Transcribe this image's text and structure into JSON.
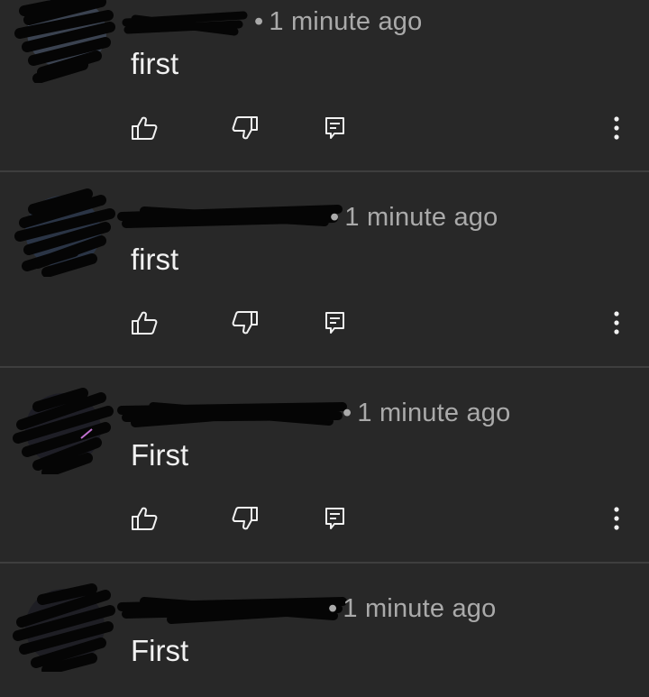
{
  "comments": [
    {
      "timestamp": "1 minute ago",
      "dot": "•",
      "text": "first",
      "icons": [
        "like-icon",
        "dislike-icon",
        "reply-icon",
        "more-vert-icon"
      ]
    },
    {
      "timestamp": "1 minute ago",
      "dot": "•",
      "text": "first",
      "icons": [
        "like-icon",
        "dislike-icon",
        "reply-icon",
        "more-vert-icon"
      ]
    },
    {
      "timestamp": "1 minute ago",
      "dot": "•",
      "text": "First",
      "icons": [
        "like-icon",
        "dislike-icon",
        "reply-icon",
        "more-vert-icon"
      ]
    },
    {
      "timestamp": "1 minute ago",
      "dot": "•",
      "text": "First"
    }
  ],
  "colors": {
    "background": "#282828",
    "divider": "#3e3e3e",
    "meta_text": "#aaaaaa",
    "body_text": "#f1f1f1",
    "redaction": "#050505"
  }
}
